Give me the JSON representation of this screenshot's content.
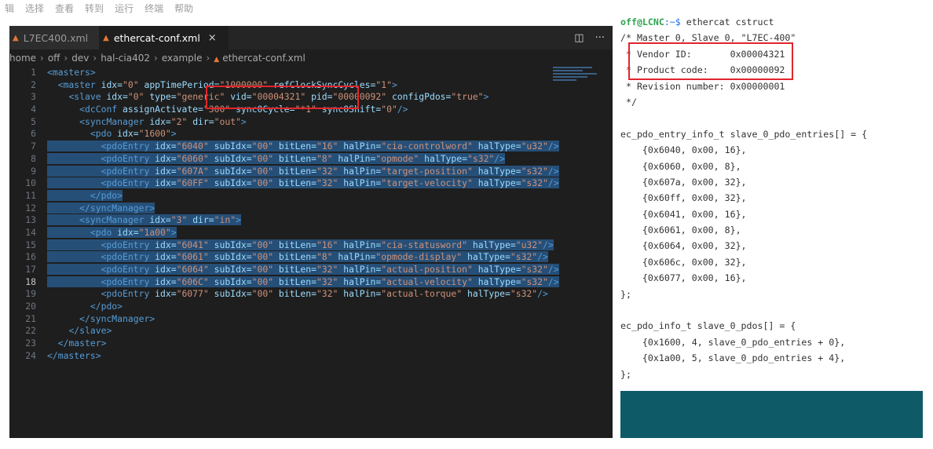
{
  "menubar": {
    "items": [
      "辑",
      "选择",
      "查看",
      "转到",
      "运行",
      "终端",
      "帮助"
    ]
  },
  "editor": {
    "tabs": [
      {
        "label": "L7EC400.xml",
        "active": false
      },
      {
        "label": "ethercat-conf.xml",
        "active": true,
        "close": "×"
      }
    ],
    "actions": {
      "split": "◫",
      "more": "···"
    },
    "breadcrumb": {
      "parts": [
        "home",
        "off",
        "dev",
        "hal-cia402",
        "example"
      ],
      "file": "ethercat-conf.xml",
      "sep": "›"
    },
    "current_line": 18,
    "lines": [
      [
        [
          "t",
          "<masters>"
        ]
      ],
      [
        [
          "p",
          "  "
        ],
        [
          "t",
          "<master "
        ],
        [
          "a",
          "idx="
        ],
        [
          "v",
          "\"0\" "
        ],
        [
          "a",
          "appTimePeriod="
        ],
        [
          "v",
          "\"1000000\" "
        ],
        [
          "a",
          "refClockSyncCycles="
        ],
        [
          "v",
          "\"1\""
        ],
        [
          "t",
          ">"
        ]
      ],
      [
        [
          "p",
          "    "
        ],
        [
          "t",
          "<slave "
        ],
        [
          "a",
          "idx="
        ],
        [
          "v",
          "\"0\" "
        ],
        [
          "a",
          "type="
        ],
        [
          "v",
          "\"generic\" "
        ],
        [
          "a",
          "vid="
        ],
        [
          "v",
          "\"00004321\" "
        ],
        [
          "a",
          "pid="
        ],
        [
          "v",
          "\"00000092\" "
        ],
        [
          "a",
          "configPdos="
        ],
        [
          "v",
          "\"true\""
        ],
        [
          "t",
          ">"
        ]
      ],
      [
        [
          "p",
          "      "
        ],
        [
          "t",
          "<dcConf "
        ],
        [
          "a",
          "assignActivate="
        ],
        [
          "v",
          "\"300\" "
        ],
        [
          "a",
          "sync0Cycle="
        ],
        [
          "v",
          "\"*1\" "
        ],
        [
          "a",
          "sync0Shift="
        ],
        [
          "v",
          "\"0\""
        ],
        [
          "t",
          "/>"
        ]
      ],
      [
        [
          "p",
          "      "
        ],
        [
          "t",
          "<syncManager "
        ],
        [
          "a",
          "idx="
        ],
        [
          "v",
          "\"2\" "
        ],
        [
          "a",
          "dir="
        ],
        [
          "v",
          "\"out\""
        ],
        [
          "t",
          ">"
        ]
      ],
      [
        [
          "p",
          "        "
        ],
        [
          "t",
          "<pdo "
        ],
        [
          "a",
          "idx="
        ],
        [
          "v",
          "\"1600\""
        ],
        [
          "t",
          ">"
        ]
      ],
      [
        [
          "p",
          "          "
        ],
        [
          "t",
          "<pdoEntry "
        ],
        [
          "a",
          "idx="
        ],
        [
          "v",
          "\"6040\" "
        ],
        [
          "a",
          "subIdx="
        ],
        [
          "v",
          "\"00\" "
        ],
        [
          "a",
          "bitLen="
        ],
        [
          "v",
          "\"16\" "
        ],
        [
          "a",
          "halPin="
        ],
        [
          "v",
          "\"cia-controlword\" "
        ],
        [
          "a",
          "halType="
        ],
        [
          "v",
          "\"u32\""
        ],
        [
          "t",
          "/>"
        ]
      ],
      [
        [
          "p",
          "          "
        ],
        [
          "t",
          "<pdoEntry "
        ],
        [
          "a",
          "idx="
        ],
        [
          "v",
          "\"6060\" "
        ],
        [
          "a",
          "subIdx="
        ],
        [
          "v",
          "\"00\" "
        ],
        [
          "a",
          "bitLen="
        ],
        [
          "v",
          "\"8\" "
        ],
        [
          "a",
          "halPin="
        ],
        [
          "v",
          "\"opmode\" "
        ],
        [
          "a",
          "halType="
        ],
        [
          "v",
          "\"s32\""
        ],
        [
          "t",
          "/>"
        ]
      ],
      [
        [
          "p",
          "          "
        ],
        [
          "t",
          "<pdoEntry "
        ],
        [
          "a",
          "idx="
        ],
        [
          "v",
          "\"607A\" "
        ],
        [
          "a",
          "subIdx="
        ],
        [
          "v",
          "\"00\" "
        ],
        [
          "a",
          "bitLen="
        ],
        [
          "v",
          "\"32\" "
        ],
        [
          "a",
          "halPin="
        ],
        [
          "v",
          "\"target-position\" "
        ],
        [
          "a",
          "halType="
        ],
        [
          "v",
          "\"s32\""
        ],
        [
          "t",
          "/>"
        ]
      ],
      [
        [
          "p",
          "          "
        ],
        [
          "t",
          "<pdoEntry "
        ],
        [
          "a",
          "idx="
        ],
        [
          "v",
          "\"60FF\" "
        ],
        [
          "a",
          "subIdx="
        ],
        [
          "v",
          "\"00\" "
        ],
        [
          "a",
          "bitLen="
        ],
        [
          "v",
          "\"32\" "
        ],
        [
          "a",
          "halPin="
        ],
        [
          "v",
          "\"target-velocity\" "
        ],
        [
          "a",
          "halType="
        ],
        [
          "v",
          "\"s32\""
        ],
        [
          "t",
          "/>"
        ]
      ],
      [
        [
          "p",
          "        "
        ],
        [
          "t",
          "</pdo>"
        ]
      ],
      [
        [
          "p",
          "      "
        ],
        [
          "t",
          "</syncManager>"
        ]
      ],
      [
        [
          "p",
          "      "
        ],
        [
          "t",
          "<syncManager "
        ],
        [
          "a",
          "idx="
        ],
        [
          "v",
          "\"3\" "
        ],
        [
          "a",
          "dir="
        ],
        [
          "v",
          "\"in\""
        ],
        [
          "t",
          ">"
        ]
      ],
      [
        [
          "p",
          "        "
        ],
        [
          "t",
          "<pdo "
        ],
        [
          "a",
          "idx="
        ],
        [
          "v",
          "\"1a00\""
        ],
        [
          "t",
          ">"
        ]
      ],
      [
        [
          "p",
          "          "
        ],
        [
          "t",
          "<pdoEntry "
        ],
        [
          "a",
          "idx="
        ],
        [
          "v",
          "\"6041\" "
        ],
        [
          "a",
          "subIdx="
        ],
        [
          "v",
          "\"00\" "
        ],
        [
          "a",
          "bitLen="
        ],
        [
          "v",
          "\"16\" "
        ],
        [
          "a",
          "halPin="
        ],
        [
          "v",
          "\"cia-statusword\" "
        ],
        [
          "a",
          "halType="
        ],
        [
          "v",
          "\"u32\""
        ],
        [
          "t",
          "/>"
        ]
      ],
      [
        [
          "p",
          "          "
        ],
        [
          "t",
          "<pdoEntry "
        ],
        [
          "a",
          "idx="
        ],
        [
          "v",
          "\"6061\" "
        ],
        [
          "a",
          "subIdx="
        ],
        [
          "v",
          "\"00\" "
        ],
        [
          "a",
          "bitLen="
        ],
        [
          "v",
          "\"8\" "
        ],
        [
          "a",
          "halPin="
        ],
        [
          "v",
          "\"opmode-display\" "
        ],
        [
          "a",
          "halType="
        ],
        [
          "v",
          "\"s32\""
        ],
        [
          "t",
          "/>"
        ]
      ],
      [
        [
          "p",
          "          "
        ],
        [
          "t",
          "<pdoEntry "
        ],
        [
          "a",
          "idx="
        ],
        [
          "v",
          "\"6064\" "
        ],
        [
          "a",
          "subIdx="
        ],
        [
          "v",
          "\"00\" "
        ],
        [
          "a",
          "bitLen="
        ],
        [
          "v",
          "\"32\" "
        ],
        [
          "a",
          "halPin="
        ],
        [
          "v",
          "\"actual-position\" "
        ],
        [
          "a",
          "halType="
        ],
        [
          "v",
          "\"s32\""
        ],
        [
          "t",
          "/>"
        ]
      ],
      [
        [
          "p",
          "          "
        ],
        [
          "t",
          "<pdoEntry "
        ],
        [
          "a",
          "idx="
        ],
        [
          "v",
          "\"606C\" "
        ],
        [
          "a",
          "subIdx="
        ],
        [
          "v",
          "\"00\" "
        ],
        [
          "a",
          "bitLen="
        ],
        [
          "v",
          "\"32\" "
        ],
        [
          "a",
          "halPin="
        ],
        [
          "v",
          "\"actual-velocity\" "
        ],
        [
          "a",
          "halType="
        ],
        [
          "v",
          "\"s32\""
        ],
        [
          "t",
          "/>"
        ]
      ],
      [
        [
          "p",
          "          "
        ],
        [
          "t",
          "<pdoEntry "
        ],
        [
          "a",
          "idx="
        ],
        [
          "v",
          "\"6077\" "
        ],
        [
          "a",
          "subIdx="
        ],
        [
          "v",
          "\"00\" "
        ],
        [
          "a",
          "bitLen="
        ],
        [
          "v",
          "\"32\" "
        ],
        [
          "a",
          "halPin="
        ],
        [
          "v",
          "\"actual-torque\" "
        ],
        [
          "a",
          "halType="
        ],
        [
          "v",
          "\"s32\""
        ],
        [
          "t",
          "/>"
        ]
      ],
      [
        [
          "p",
          "        "
        ],
        [
          "t",
          "</pdo>"
        ]
      ],
      [
        [
          "p",
          "      "
        ],
        [
          "t",
          "</syncManager>"
        ]
      ],
      [
        [
          "p",
          "    "
        ],
        [
          "t",
          "</slave>"
        ]
      ],
      [
        [
          "p",
          "  "
        ],
        [
          "t",
          "</master>"
        ]
      ],
      [
        [
          "t",
          "</masters>"
        ]
      ]
    ],
    "selected_lines": [
      7,
      8,
      9,
      10,
      11,
      12,
      13,
      14,
      15,
      16,
      17,
      18
    ]
  },
  "terminal": {
    "prompt_user": "off@LCNC",
    "prompt_path": ":~$ ",
    "command": "ethercat cstruct",
    "lines": [
      "/* Master 0, Slave 0, \"L7EC-400\"",
      " * Vendor ID:       0x00004321",
      " * Product code:    0x00000092",
      " * Revision number: 0x00000001",
      " */",
      "",
      "ec_pdo_entry_info_t slave_0_pdo_entries[] = {",
      "    {0x6040, 0x00, 16},",
      "    {0x6060, 0x00, 8},",
      "    {0x607a, 0x00, 32},",
      "    {0x60ff, 0x00, 32},",
      "    {0x6041, 0x00, 16},",
      "    {0x6061, 0x00, 8},",
      "    {0x6064, 0x00, 32},",
      "    {0x606c, 0x00, 32},",
      "    {0x6077, 0x00, 16},",
      "};",
      "",
      "ec_pdo_info_t slave_0_pdos[] = {",
      "    {0x1600, 4, slave_0_pdo_entries + 0},",
      "    {0x1a00, 5, slave_0_pdo_entries + 4},",
      "};"
    ]
  },
  "colors": {
    "highlight_box": "#e0262c",
    "selection": "#264f78",
    "terminal_bottom": "#0f5a67"
  }
}
